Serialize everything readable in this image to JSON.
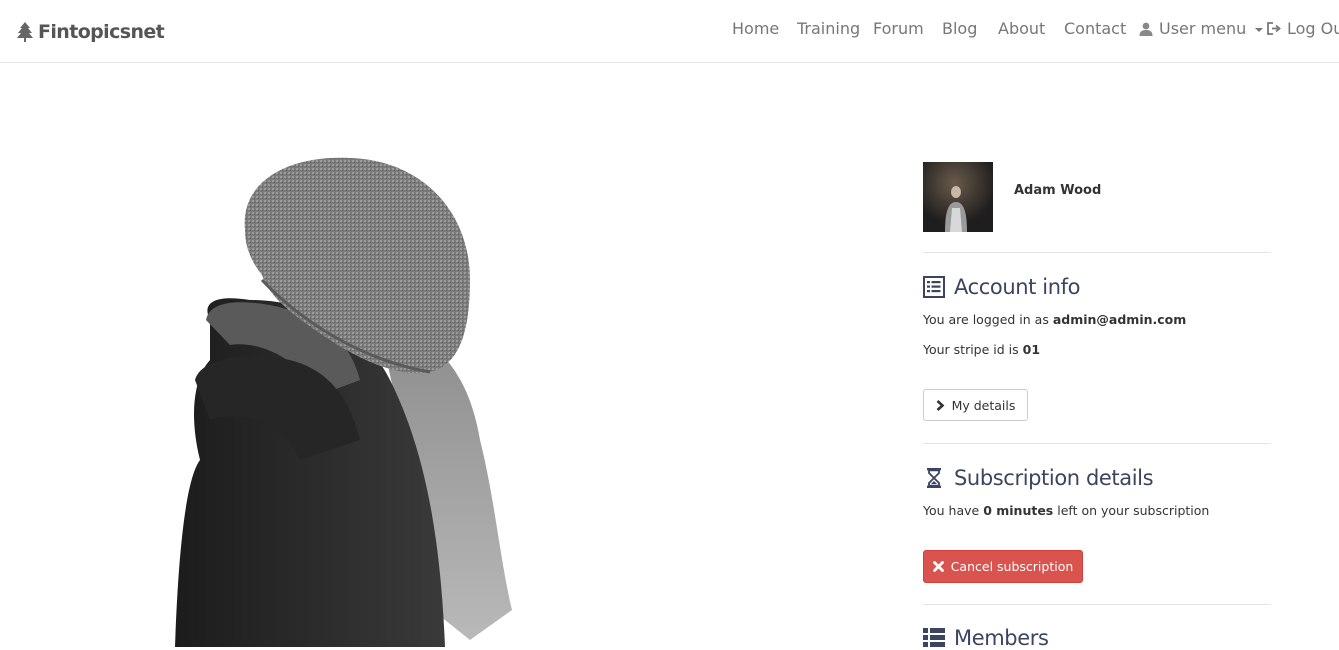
{
  "brand": {
    "name": "Fintopicsnet",
    "icon": "tree-icon"
  },
  "nav": {
    "home": "Home",
    "training": "Training",
    "forum": "Forum",
    "blog": "Blog",
    "about": "About",
    "contact": "Contact",
    "user_menu": "User menu",
    "logout": "Log Out"
  },
  "profile": {
    "name": "Adam Wood"
  },
  "account": {
    "title": "Account info",
    "logged_in_prefix": "You are logged in as",
    "email": "admin@admin.com",
    "stripe_prefix": "Your stripe id is",
    "stripe_id": "01",
    "details_button": "My details"
  },
  "subscription": {
    "title": "Subscription details",
    "prefix": "You have",
    "remaining": "0 minutes",
    "suffix": "left on your subscription",
    "cancel_button": "Cancel subscription"
  },
  "members": {
    "title": "Members"
  },
  "colors": {
    "accent": "#3c4460",
    "danger": "#d9534f",
    "nav_text": "#777777"
  }
}
